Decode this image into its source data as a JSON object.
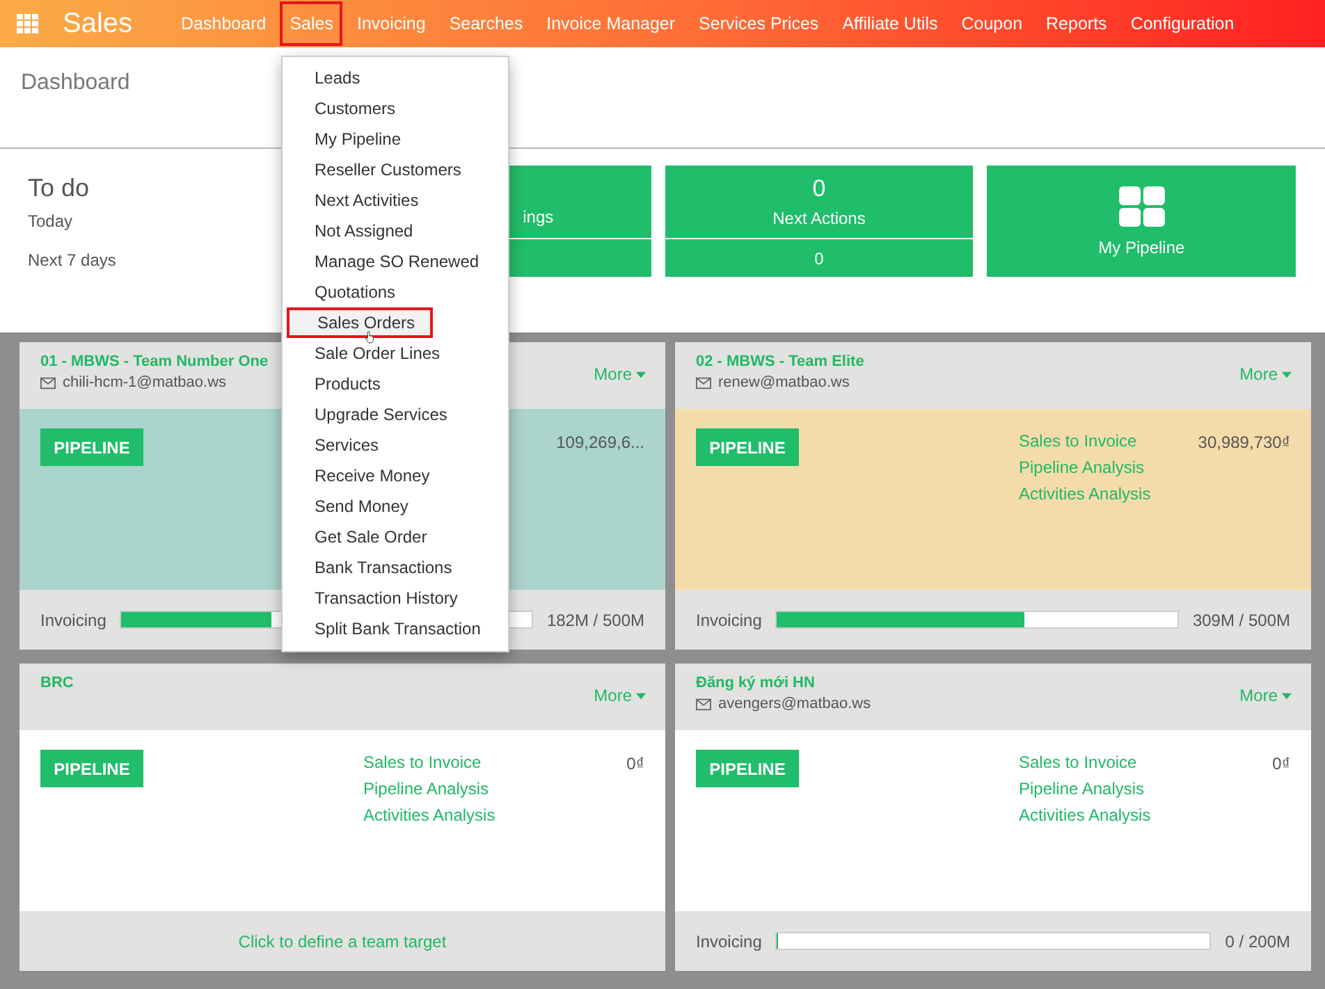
{
  "app": {
    "title": "Sales"
  },
  "nav": [
    {
      "label": "Dashboard",
      "selected": false
    },
    {
      "label": "Sales",
      "selected": true
    },
    {
      "label": "Invoicing",
      "selected": false
    },
    {
      "label": "Searches",
      "selected": false
    },
    {
      "label": "Invoice Manager",
      "selected": false
    },
    {
      "label": "Services Prices",
      "selected": false
    },
    {
      "label": "Affiliate Utils",
      "selected": false
    },
    {
      "label": "Coupon",
      "selected": false
    },
    {
      "label": "Reports",
      "selected": false
    },
    {
      "label": "Configuration",
      "selected": false
    }
  ],
  "menu": [
    {
      "label": "Leads",
      "selected": false
    },
    {
      "label": "Customers",
      "selected": false
    },
    {
      "label": "My Pipeline",
      "selected": false
    },
    {
      "label": "Reseller Customers",
      "selected": false
    },
    {
      "label": "Next Activities",
      "selected": false
    },
    {
      "label": "Not Assigned",
      "selected": false
    },
    {
      "label": "Manage SO Renewed",
      "selected": false
    },
    {
      "label": "Quotations",
      "selected": false
    },
    {
      "label": "Sales Orders",
      "selected": true
    },
    {
      "label": "Sale Order Lines",
      "selected": false
    },
    {
      "label": "Products",
      "selected": false
    },
    {
      "label": "Upgrade Services",
      "selected": false
    },
    {
      "label": "Services",
      "selected": false
    },
    {
      "label": "Receive Money",
      "selected": false
    },
    {
      "label": "Send Money",
      "selected": false
    },
    {
      "label": "Get Sale Order",
      "selected": false
    },
    {
      "label": "Bank Transactions",
      "selected": false
    },
    {
      "label": "Transaction History",
      "selected": false
    },
    {
      "label": "Split Bank Transaction",
      "selected": false
    }
  ],
  "breadcrumb": "Dashboard",
  "todo": {
    "title": "To do",
    "rows": [
      "Today",
      "Next 7 days"
    ]
  },
  "todo_cards": [
    {
      "kind": "stat",
      "label": "ings"
    },
    {
      "kind": "stat",
      "value": "0",
      "label": "Next Actions",
      "sub_value": "0"
    },
    {
      "kind": "link",
      "label": "My Pipeline"
    }
  ],
  "teams": [
    {
      "name": "01 - MBWS - Team Number One",
      "email": "chili-hcm-1@matbao.ws",
      "more": "More",
      "color": "#aad4cc",
      "button": "PIPELINE",
      "amount": "109,269,6...",
      "footer": {
        "kind": "progress",
        "label": "Invoicing",
        "level": 0.364,
        "reading": "182M / 500M"
      }
    },
    {
      "name": "02 - MBWS - Team Elite",
      "email": "renew@matbao.ws",
      "more": "More",
      "color": "#f4dcaa",
      "button": "PIPELINE",
      "links": [
        "Sales to Invoice",
        "Pipeline Analysis",
        "Activities Analysis"
      ],
      "amount": "30,989,730₫",
      "footer": {
        "kind": "progress",
        "label": "Invoicing",
        "level": 0.618,
        "reading": "309M / 500M"
      }
    },
    {
      "name": "BRC",
      "more": "More",
      "color": "#ffffff",
      "button": "PIPELINE",
      "links": [
        "Sales to Invoice",
        "Pipeline Analysis",
        "Activities Analysis"
      ],
      "amount": "0₫",
      "footer": {
        "kind": "target",
        "text": "Click to define a team target"
      }
    },
    {
      "name": "Đăng ký mới HN",
      "email": "avengers@matbao.ws",
      "more": "More",
      "color": "#ffffff",
      "button": "PIPELINE",
      "links": [
        "Sales to Invoice",
        "Pipeline Analysis",
        "Activities Analysis"
      ],
      "amount": "0₫",
      "footer": {
        "kind": "progress",
        "label": "Invoicing",
        "level": 0,
        "reading": "0 / 200M"
      }
    }
  ]
}
